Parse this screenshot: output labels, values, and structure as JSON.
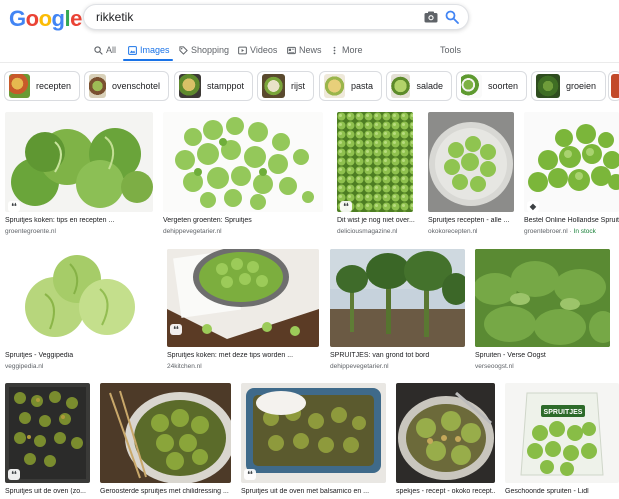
{
  "logo": [
    "G",
    "o",
    "o",
    "g",
    "l",
    "e"
  ],
  "search": {
    "query": "rikketik"
  },
  "tabs": [
    {
      "label": "All",
      "icon": "search-icon"
    },
    {
      "label": "Images",
      "icon": "image-icon",
      "active": true
    },
    {
      "label": "Shopping",
      "icon": "tag-icon"
    },
    {
      "label": "Videos",
      "icon": "play-icon"
    },
    {
      "label": "News",
      "icon": "news-icon"
    },
    {
      "label": "More",
      "icon": "more-icon"
    }
  ],
  "tools_label": "Tools",
  "chips": [
    "recepten",
    "ovenschotel",
    "stamppot",
    "rijst",
    "pasta",
    "salade",
    "soorten",
    "groeien"
  ],
  "results": [
    {
      "title": "Spruitjes koken: tips en recepten ...",
      "source": "groentegroente.nl"
    },
    {
      "title": "Vergeten groenten: Spruitjes",
      "source": "dehippevegetarier.nl"
    },
    {
      "title": "Dit wist je nog niet over...",
      "source": "deliciousmagazine.nl"
    },
    {
      "title": "Spruitjes recepten - alle ...",
      "source": "okokorecepten.nl"
    },
    {
      "title": "Bestel Online Hollandse Spruit",
      "source": "groentebroer.nl",
      "stock": "In stock"
    },
    {
      "title": "Spruitjes - Veggipedia",
      "source": "veggipedia.nl"
    },
    {
      "title": "Spruitjes koken: met deze tips worden ...",
      "source": "24kitchen.nl"
    },
    {
      "title": "SPRUITJES: van grond tot bord",
      "source": "dehippevegetarier.nl"
    },
    {
      "title": "Spruiten - Verse Oogst",
      "source": "verseoogst.nl"
    },
    {
      "title": "Spruitjes uit de oven (zo...",
      "source": ""
    },
    {
      "title": "Geroosterde spruitjes met chilidressing ...",
      "source": ""
    },
    {
      "title": "Spruitjes uit de oven met balsamico en ...",
      "source": ""
    },
    {
      "title": "spekjes - recept - okoko recept...",
      "source": ""
    },
    {
      "title": "Geschoonde spruiten - Lidl",
      "source": ""
    }
  ],
  "lidl_bag_text": "SPRUITJES",
  "colors": {
    "accent": "#1a73e8",
    "sprout_light": "#9fd063",
    "sprout_dark": "#4c8a24"
  }
}
